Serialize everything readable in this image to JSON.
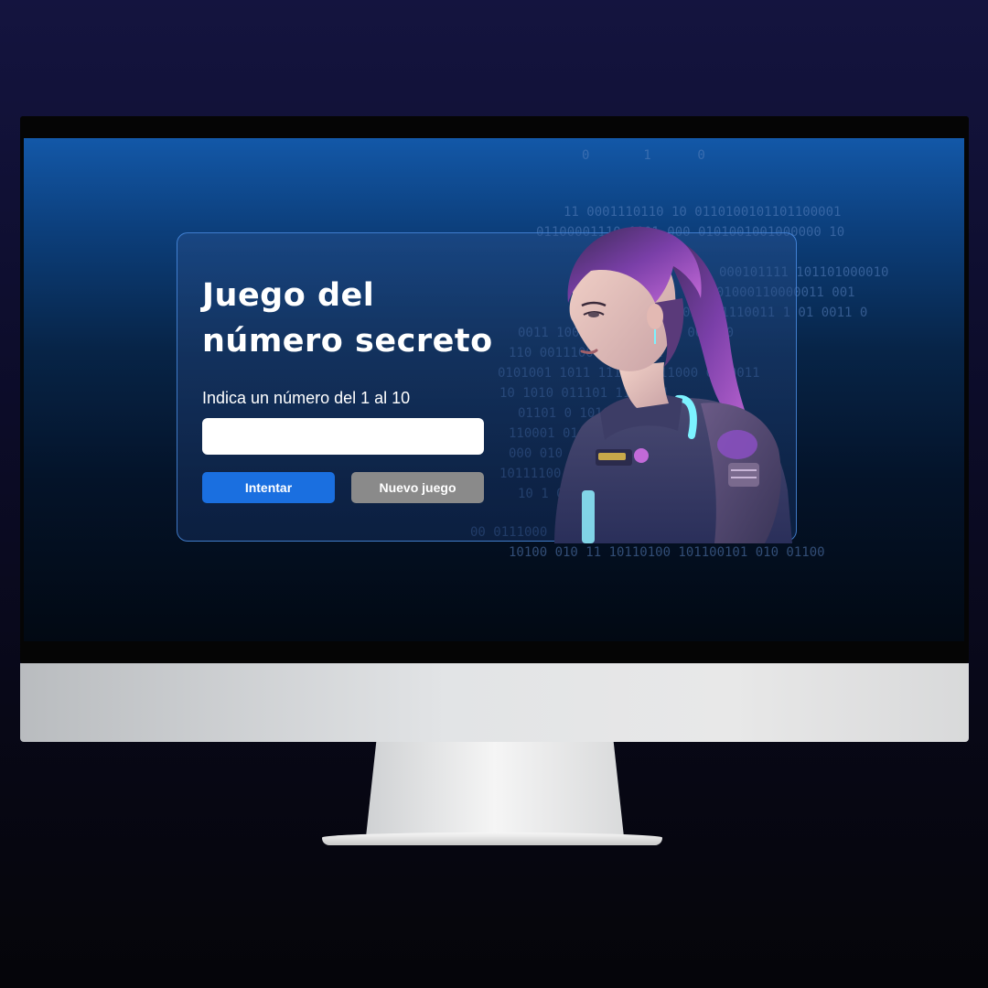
{
  "game": {
    "title_line1": "Juego del",
    "title_line2": "número secreto",
    "input_label": "Indica un número del 1 al 10",
    "input_value": "",
    "try_button": "Intentar",
    "new_game_button": "Nuevo juego"
  },
  "binary_rows": [
    "0       1      0",
    "11 0001110110 10 0110100101101100001",
    "01100001110 0001 000 0101001001000000 10",
    "000101111 101101000010",
    "1101000110000011 001",
    "0101 1110011 1 01 0011 0",
    "0011 1000111 011 1000 001 10",
    "110 0011100000 01101",
    "0101001 1011 1111010011000 0100011",
    "10 1010 011101 1110111",
    "01101 0 1010 111111 01000",
    "110001 01 0 10001101000110",
    "000 010 1 0101 0 1 11010111000 1010",
    "10111100 10 00 0 1 0001 11 1",
    "10 1 0111 01 1 100100 110100011 0",
    "00 0111000 0001 0101 11011",
    "10100 010 11 10110100 101100101 010 01100"
  ],
  "colors": {
    "accent": "#1a6fe0",
    "secondary_button": "#8a8a8a",
    "card_border": "#5096f0",
    "screen_top": "#1358a8",
    "screen_bottom": "#020913"
  },
  "icons": {
    "illustration": "cyberpunk-girl-illustration"
  }
}
